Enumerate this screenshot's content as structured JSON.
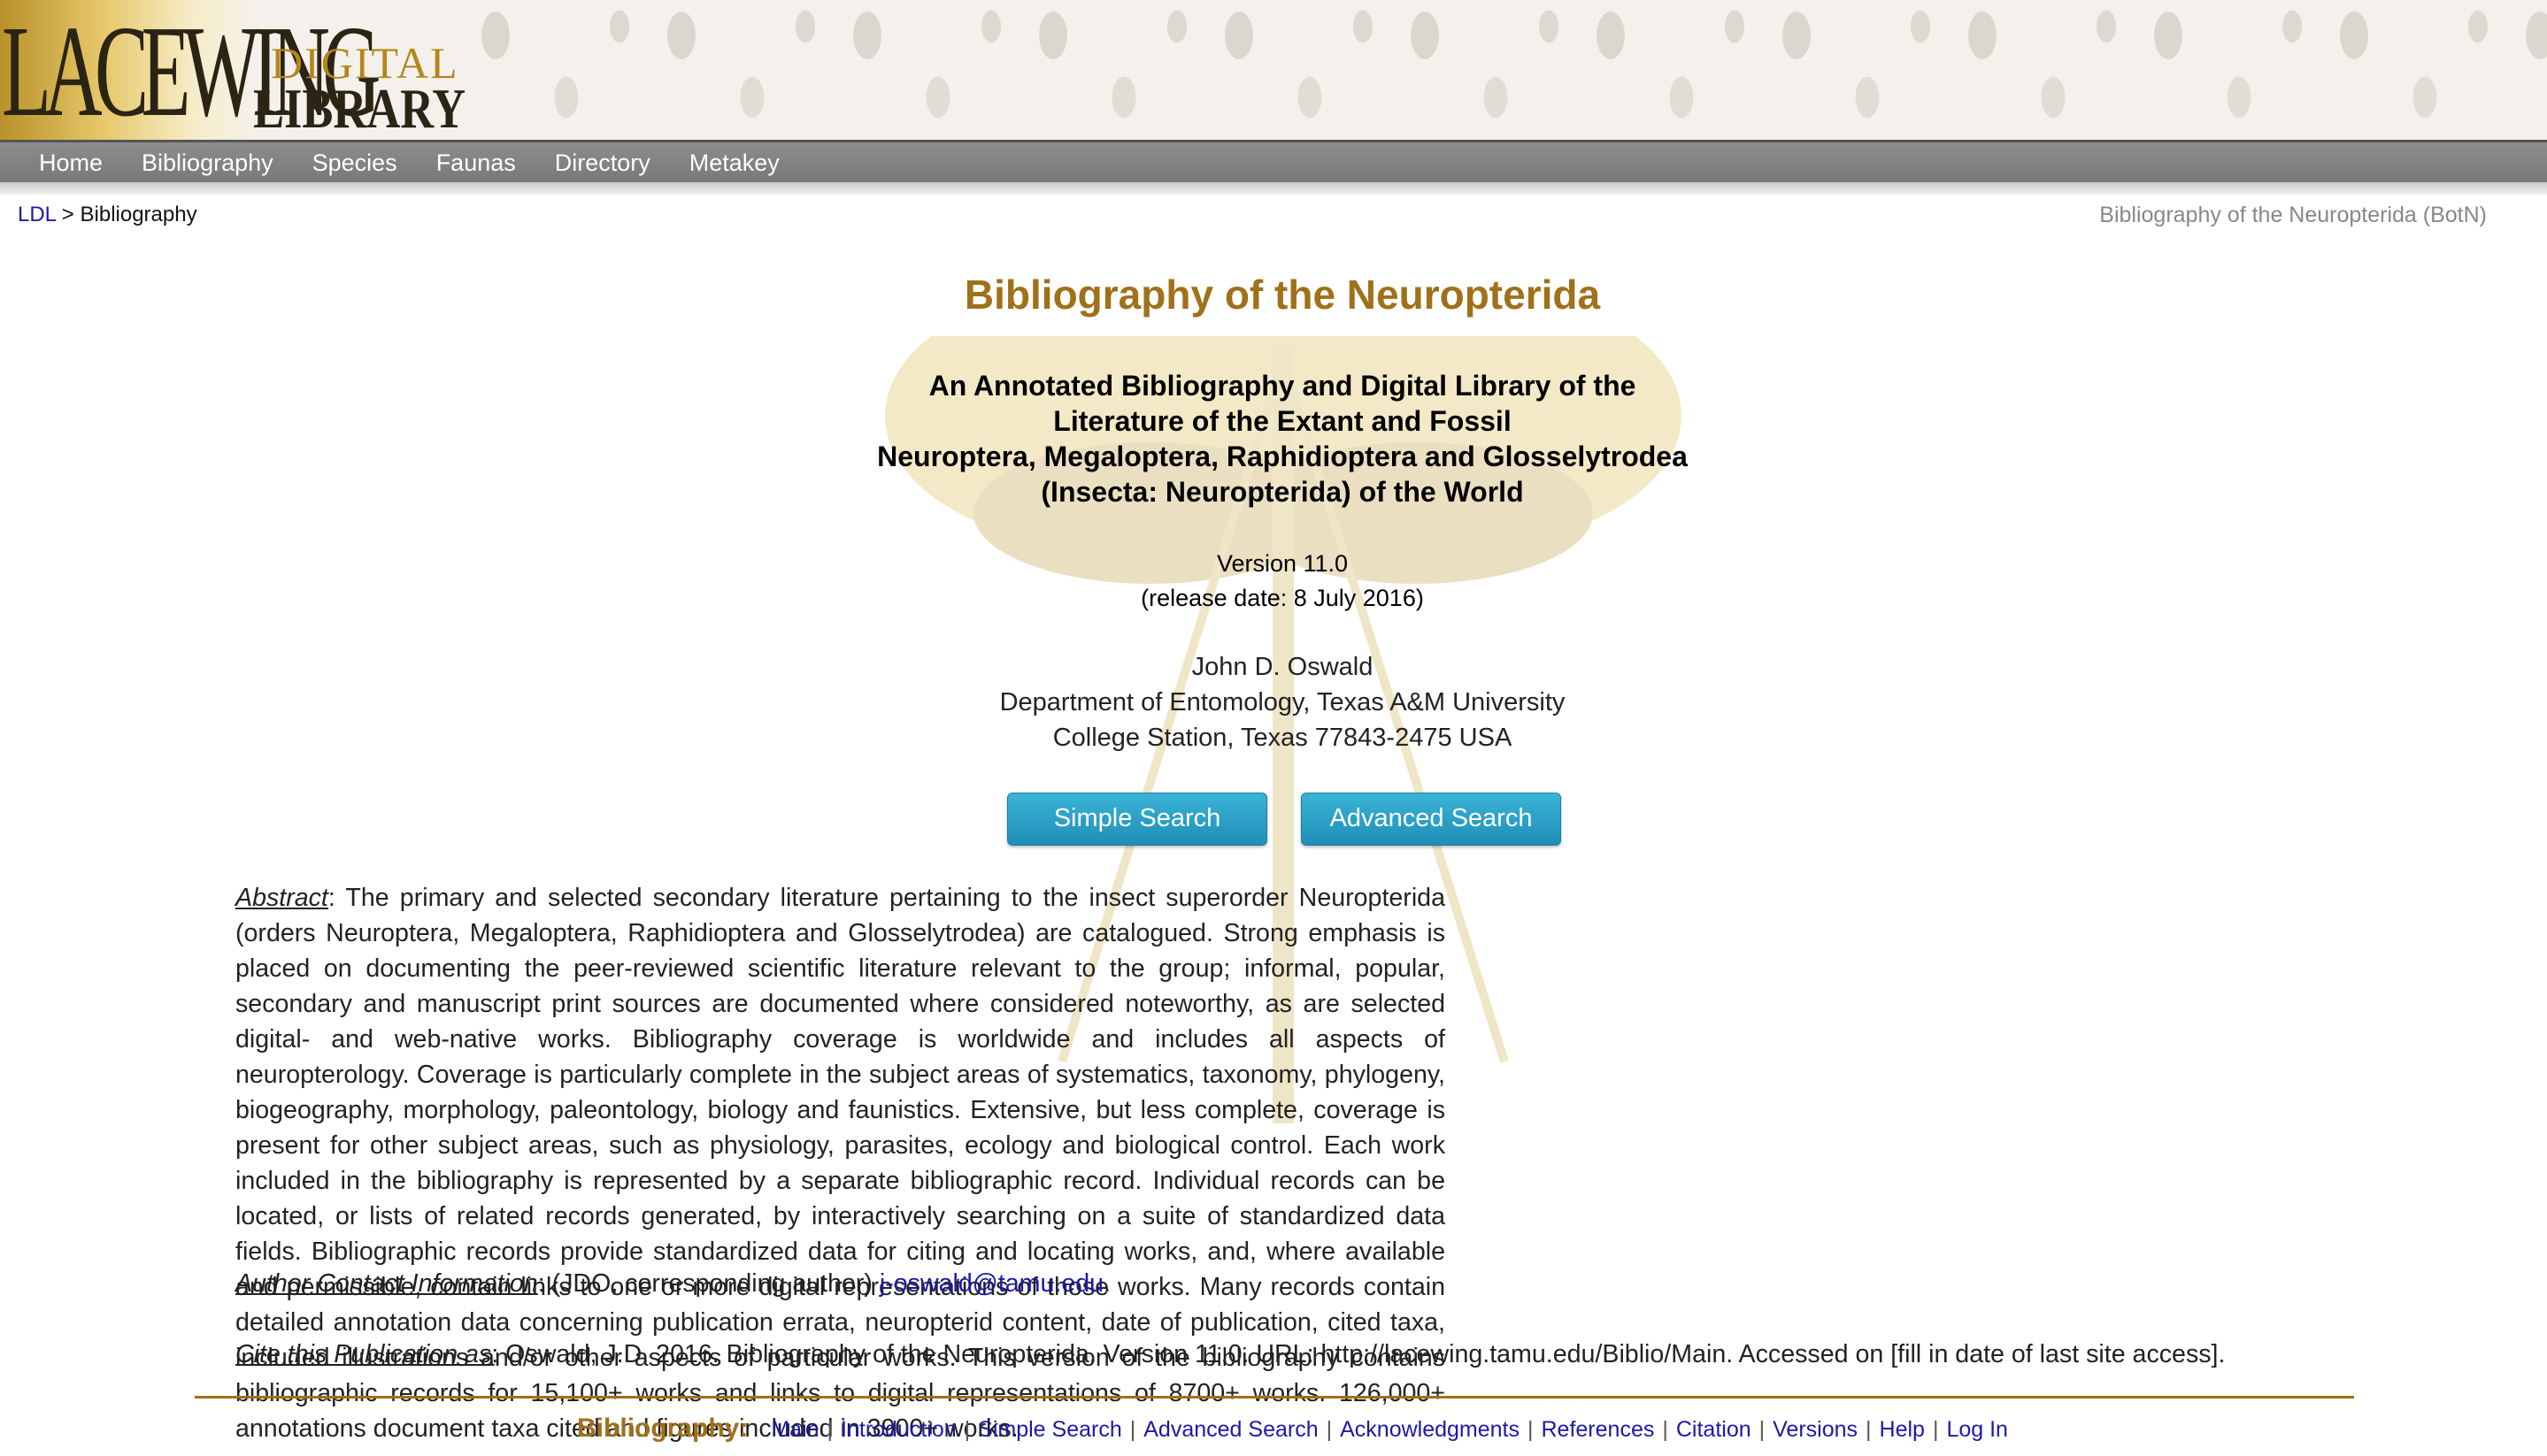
{
  "logo": {
    "word1": "LACEWING",
    "word2": "DIGITAL",
    "word3": "LIBRARY"
  },
  "nav": [
    "Home",
    "Bibliography",
    "Species",
    "Faunas",
    "Directory",
    "Metakey"
  ],
  "breadcrumb": {
    "root": "LDL",
    "sep": " > ",
    "current": "Bibliography"
  },
  "site_title": "Bibliography of the Neuropterida (BotN)",
  "title": "Bibliography of the Neuropterida",
  "subtitle": [
    "An Annotated Bibliography and Digital Library of the",
    "Literature of the Extant and Fossil",
    "Neuroptera, Megaloptera, Raphidioptera and Glosselytrodea",
    "(Insecta: Neuropterida) of the World"
  ],
  "version": {
    "line1": "Version 11.0",
    "line2": "(release date: 8 July 2016)"
  },
  "author": {
    "name": "John D. Oswald",
    "dept": "Department of Entomology, Texas A&M University",
    "address": "College Station, Texas 77843-2475 USA"
  },
  "buttons": {
    "simple": "Simple Search",
    "advanced": "Advanced Search"
  },
  "abstract": {
    "label": "Abstract",
    "text": ": The primary and selected secondary literature pertaining to the insect superorder Neuropterida (orders Neuroptera, Megaloptera, Raphidioptera and Glosselytrodea) are catalogued. Strong emphasis is placed on documenting the peer-reviewed scientific literature relevant to the group; informal, popular, secondary and manuscript print sources are documented where considered noteworthy, as are selected digital- and web-native works. Bibliography coverage is worldwide and includes all aspects of neuropterology. Coverage is particularly complete in the subject areas of systematics, taxonomy, phylogeny, biogeography, morphology, paleontology, biology and faunistics. Extensive, but less complete, coverage is present for other subject areas, such as physiology, parasites, ecology and biological control. Each work included in the bibliography is represented by a separate bibliographic record. Individual records can be located, or lists of related records generated, by interactively searching on a suite of standardized data fields. Bibliographic records provide standardized data for citing and locating works, and, where available and permissible, contain links to one or more digital representations of those works. Many records contain detailed annotation data concerning publication errata, neuropterid content, date of publication, cited taxa, included illustrations and/or other aspects of particular works. This version of the bibliography contains bibliographic records for 15,100+ works and links to digital representations of 8700+ works. 126,000+ annotations document taxa cited and figures included in 3900+ works."
  },
  "contact": {
    "label": "Author Contact Information",
    "text": ": (JDO, corresponding author) ",
    "email": "j-oswald@tamu.edu",
    "end": "."
  },
  "cite": {
    "label": "Cite this Publication as",
    "text": ": Oswald, J.D. 2016. Bibliography of the Neuropterida. Version 11.0. URL: http://lacewing.tamu.edu/Biblio/Main. Accessed on [fill in date of last site access]."
  },
  "footer": {
    "label": "Bibliography:",
    "links": [
      "Main",
      "Introduction",
      "Simple Search",
      "Advanced Search",
      "Acknowledgments",
      "References",
      "Citation",
      "Versions",
      "Help",
      "Log In"
    ]
  },
  "colors": {
    "accent": "#a0701a",
    "link": "#1a1aa6",
    "button": "#2aa3c9",
    "nav": "#808080"
  }
}
